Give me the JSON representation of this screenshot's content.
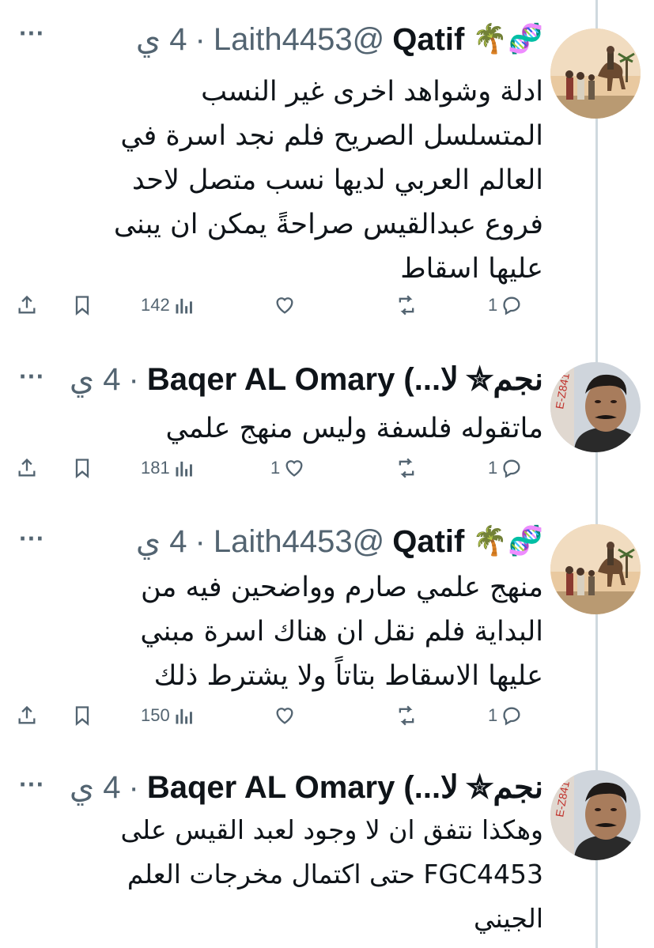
{
  "colors": {
    "text": "#0f1419",
    "muted": "#536471",
    "thread_line": "#cfd9de"
  },
  "tweets": [
    {
      "emoji": "🧬🌴",
      "name": "Qatif",
      "handle": "@Laith4453",
      "dot": "·",
      "time": "4 ي",
      "body": "ادلة وشواهد اخرى غير النسب\nالمتسلسل الصريح فلم نجد اسرة في\nالعالم العربي لديها نسب متصل لاحد\nفروع عبدالقيس صراحةً يمكن ان يبنى\nعليها اسقاط",
      "replies": "1",
      "retweets": "",
      "likes": "",
      "views": "142",
      "avatar": "caravan-painting"
    },
    {
      "name": "Baqer AL Omary (...لا",
      "suffix": "نجم✮",
      "dot": "·",
      "time": "4 ي",
      "body": "ماتقوله فلسفة وليس منهج علمي",
      "replies": "1",
      "retweets": "",
      "likes": "1",
      "views": "181",
      "avatar": "portrait-photo",
      "avatar_stamp": "E-Z841"
    },
    {
      "emoji": "🧬🌴",
      "name": "Qatif",
      "handle": "@Laith4453",
      "dot": "·",
      "time": "4 ي",
      "body": "منهج علمي صارم وواضحين فيه من\nالبداية فلم نقل ان هناك اسرة مبني\nعليها الاسقاط بتاتاً ولا يشترط ذلك",
      "replies": "1",
      "retweets": "",
      "likes": "",
      "views": "150",
      "avatar": "caravan-painting"
    },
    {
      "name": "Baqer AL Omary (...لا",
      "suffix": "نجم✮",
      "dot": "·",
      "time": "4 ي",
      "body": "وهكذا نتفق ان لا وجود لعبد القيس على\nFGC4453 حتى اكتمال مخرجات العلم\nالجيني",
      "avatar": "portrait-photo",
      "avatar_stamp": "E-Z841"
    }
  ]
}
